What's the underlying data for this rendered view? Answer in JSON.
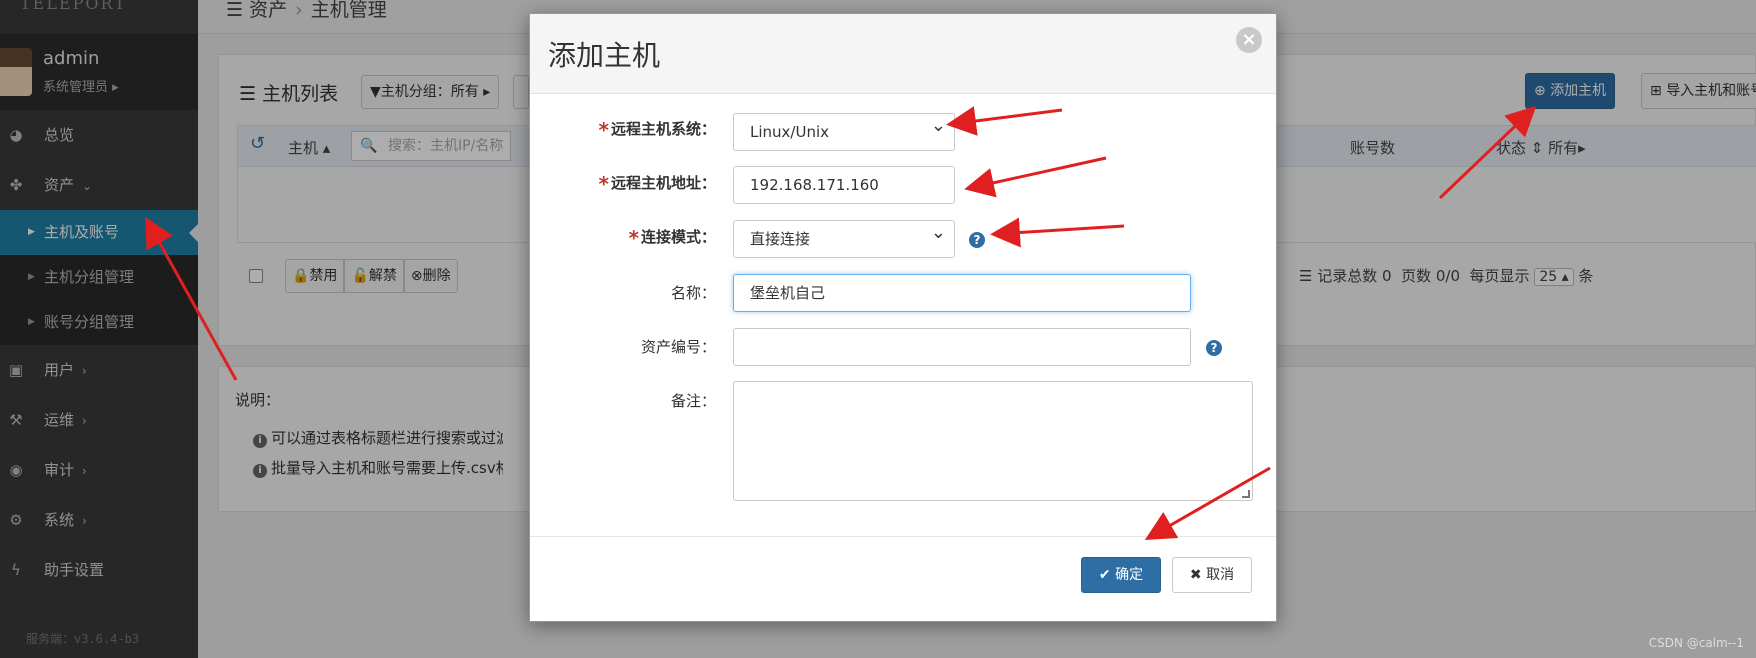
{
  "app": {
    "logo_text": "TELEPORT",
    "version": "服务端：v3.6.4-b3"
  },
  "user": {
    "name": "admin",
    "role": "系统管理员 ▸"
  },
  "sidebar": {
    "items": [
      {
        "label": "总览",
        "icon": "dashboard-icon"
      },
      {
        "label": "资产",
        "icon": "cubes-icon",
        "expanded": true
      },
      {
        "label": "用户",
        "icon": "user-book-icon"
      },
      {
        "label": "运维",
        "icon": "wrench-icon"
      },
      {
        "label": "审计",
        "icon": "eye-icon"
      },
      {
        "label": "系统",
        "icon": "gear-icon"
      },
      {
        "label": "助手设置",
        "icon": "bolt-icon"
      }
    ],
    "sub_items": [
      {
        "label": "主机及账号",
        "active": true
      },
      {
        "label": "主机分组管理"
      },
      {
        "label": "账号分组管理"
      }
    ]
  },
  "breadcrumb": {
    "root": "资产",
    "current": "主机管理"
  },
  "host_list": {
    "title": "主机列表",
    "group_filter": "主机分组：所有",
    "add_host_label": "添加主机",
    "import_label": "导入主机和账号",
    "columns": {
      "host": "主机",
      "accounts": "账号数",
      "status": "状态",
      "status_filter": "所有"
    },
    "search_placeholder": "搜索：主机IP/名称",
    "bulk": {
      "disable": "禁用",
      "unlock": "解禁",
      "delete": "删除"
    },
    "pager": {
      "total": "记录总数 0",
      "pages": "页数 0/0",
      "per_page_label": "每页显示",
      "per_page": "25 ▴",
      "suffix": "条"
    }
  },
  "notes": {
    "title": "说明：",
    "items": [
      "可以通过表格标题栏进行搜索或过滤",
      "批量导入主机和账号需要上传.csv格式"
    ]
  },
  "modal": {
    "title": "添加主机",
    "fields": {
      "os": {
        "label": "远程主机系统：",
        "value": "Linux/Unix"
      },
      "address": {
        "label": "远程主机地址：",
        "value": "192.168.171.160"
      },
      "mode": {
        "label": "连接模式：",
        "value": "直接连接"
      },
      "name": {
        "label": "名称：",
        "value": "堡垒机自己"
      },
      "asset_no": {
        "label": "资产编号：",
        "value": ""
      },
      "remark": {
        "label": "备注：",
        "value": ""
      }
    },
    "ok_label": "确定",
    "cancel_label": "取消"
  },
  "colors": {
    "primary": "#2f6ea5",
    "active_nav": "#1f7fa5",
    "required": "#c0392b",
    "arrow": "#e02020"
  },
  "watermark": "CSDN @calm--1"
}
